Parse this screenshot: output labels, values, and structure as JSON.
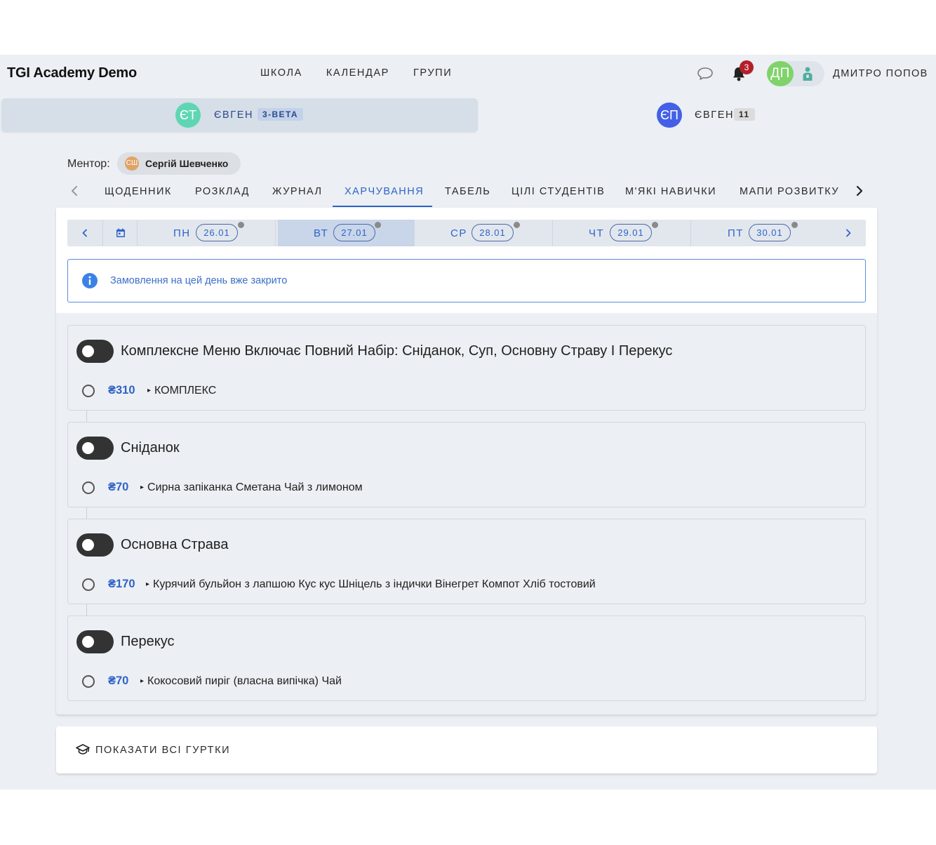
{
  "header": {
    "brand": "TGI Academy Demo",
    "nav": [
      "ШКОЛА",
      "КАЛЕНДАР",
      "ГРУПИ"
    ],
    "notifications_count": "3",
    "user_initials": "ДП",
    "user_name": "ДМИТРО ПОПОВ",
    "accent_color": "#2f63c8"
  },
  "students": [
    {
      "initials": "ЄТ",
      "name": "ЄВГЕН",
      "group": "3-ВЕТА",
      "selected": true
    },
    {
      "initials": "ЄП",
      "name": "ЄВГЕН",
      "group": "11",
      "selected": false
    }
  ],
  "mentor": {
    "label": "Ментор:",
    "initials": "СШ",
    "name": "Сергій Шевченко"
  },
  "tabs": {
    "items": [
      "ЩОДЕННИК",
      "РОЗКЛАД",
      "ЖУРНАЛ",
      "ХАРЧУВАННЯ",
      "ТАБЕЛЬ",
      "ЦІЛІ СТУДЕНТІВ",
      "М'ЯКІ НАВИЧКИ",
      "МАПИ РОЗВИТКУ"
    ],
    "active": "ХАРЧУВАННЯ"
  },
  "days": [
    {
      "label": "ПН",
      "date": "26.01",
      "active": false
    },
    {
      "label": "ВТ",
      "date": "27.01",
      "active": true
    },
    {
      "label": "СР",
      "date": "28.01",
      "active": false
    },
    {
      "label": "ЧТ",
      "date": "29.01",
      "active": false
    },
    {
      "label": "ПТ",
      "date": "30.01",
      "active": false
    }
  ],
  "notice": {
    "text": "Замовлення на цей день вже закрито"
  },
  "meals": [
    {
      "title": "Комплексне Меню Включає Повний Набір: Сніданок, Суп, Основну Страву І Перекус",
      "price": "₴310",
      "description": "КОМПЛЕКС"
    },
    {
      "title": "Сніданок",
      "price": "₴70",
      "description": "Сирна запіканка Сметана Чай з лимоном"
    },
    {
      "title": "Основна Страва",
      "price": "₴170",
      "description": "Курячий бульйон з лапшою Кус кус Шніцель з індички Вінегрет Компот Хліб тостовий"
    },
    {
      "title": "Перекус",
      "price": "₴70",
      "description": "Кокосовий пиріг (власна випічка) Чай"
    }
  ],
  "clubs": {
    "label": "ПОКАЗАТИ ВСІ ГУРТКИ"
  }
}
